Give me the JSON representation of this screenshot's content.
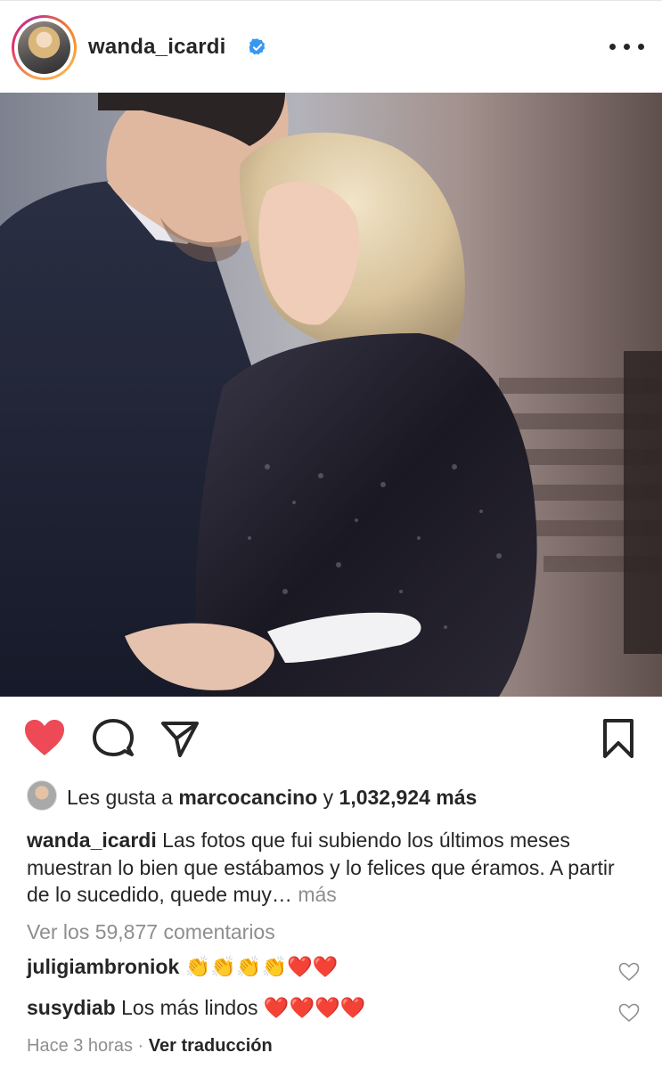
{
  "post": {
    "username": "wanda_icardi",
    "verified_icon": "verified-badge-icon",
    "more_icon": "more-options-icon"
  },
  "photo": {
    "description_icon": "post-photo"
  },
  "actions": {
    "like_icon": "heart-filled-icon",
    "comment_icon": "comment-icon",
    "share_icon": "share-icon",
    "save_icon": "bookmark-icon",
    "like_color": "#ed4956"
  },
  "likes": {
    "prefix": "Les gusta a ",
    "user": "marcocancino",
    "conj": " y ",
    "count": "1,032,924 más"
  },
  "caption": {
    "username": "wanda_icardi",
    "text": "Las fotos que fui subiendo los últimos meses muestran lo bien que estábamos y lo felices que éramos. A partir de lo sucedido, quede muy…",
    "more": "más"
  },
  "comments": {
    "view_all": "Ver los 59,877 comentarios",
    "items": [
      {
        "username": "juligiambroniok",
        "text": "",
        "emojis": "👏👏👏👏❤️❤️"
      },
      {
        "username": "susydiab",
        "text": "Los más lindos",
        "emojis": "❤️❤️❤️❤️"
      }
    ]
  },
  "meta": {
    "time": "Hace 3 horas",
    "separator": "·",
    "translate": "Ver traducción"
  }
}
